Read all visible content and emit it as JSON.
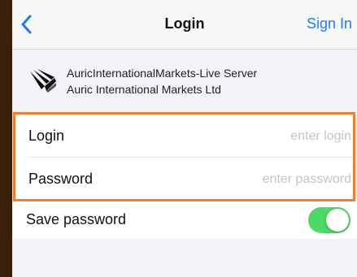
{
  "navbar": {
    "back_icon": "chevron-left-icon",
    "title": "Login",
    "action_label": "Sign In",
    "accent_color": "#1e7cf2"
  },
  "server": {
    "logo_icon": "auric-logo-icon",
    "server_name": "AuricInternationalMarkets-Live Server",
    "company": "Auric International Markets Ltd"
  },
  "form": {
    "highlight_color": "#ee7f33",
    "login_label": "Login",
    "login_placeholder": "enter login",
    "login_value": "",
    "password_label": "Password",
    "password_placeholder": "enter password",
    "password_value": ""
  },
  "save": {
    "label": "Save password",
    "enabled": true,
    "toggle_color": "#4cd964"
  }
}
